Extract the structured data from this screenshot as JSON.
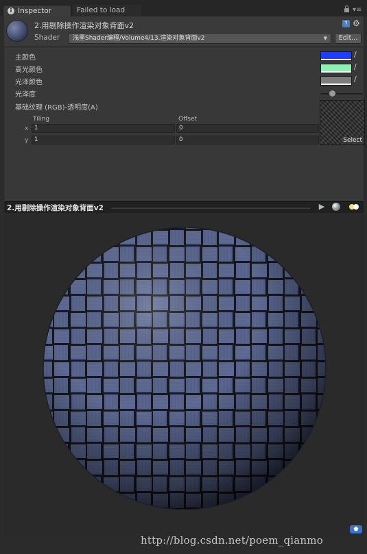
{
  "tabs": [
    {
      "label": "Inspector",
      "active": true,
      "icon": "info-icon"
    },
    {
      "label": "Failed to load",
      "active": false
    }
  ],
  "tab_menu_glyph": "▾≡",
  "header": {
    "material_name": "2.用剔除操作渲染对象背面v2",
    "shader_label": "Shader",
    "shader_value": "浅墨Shader编程/Volume4/13.渲染对象背面v2",
    "edit_label": "Edit...",
    "help_glyph": "?",
    "gear_glyph": "⚙"
  },
  "properties": {
    "main_color": {
      "label": "主颜色",
      "color": "#1f3dff"
    },
    "spec_color": {
      "label": "高光颜色",
      "color": "#8ff0b4"
    },
    "emission_color": {
      "label": "光泽颜色",
      "color": "#7d7d7d"
    },
    "shininess": {
      "label": "光泽度",
      "value": 0.27
    },
    "main_tex": {
      "label": "基础纹理 (RGB)-透明度(A)",
      "select_label": "Select"
    },
    "picker_glyph": "∕"
  },
  "tiling_offset": {
    "tiling_label": "Tiling",
    "offset_label": "Offset",
    "x_label": "x",
    "y_label": "y",
    "tiling_x": "1",
    "tiling_y": "1",
    "offset_x": "0",
    "offset_y": "0"
  },
  "preview": {
    "title": "2.用剔除操作渲染对象背面v2",
    "play_glyph": "▶",
    "tag_glyph": "⬟"
  },
  "watermark": "http://blog.csdn.net/poem_qianmo",
  "colors": {
    "panel_bg": "#383838",
    "preview_bg": "#2a2a2a",
    "weave_base": "#5a6588"
  }
}
